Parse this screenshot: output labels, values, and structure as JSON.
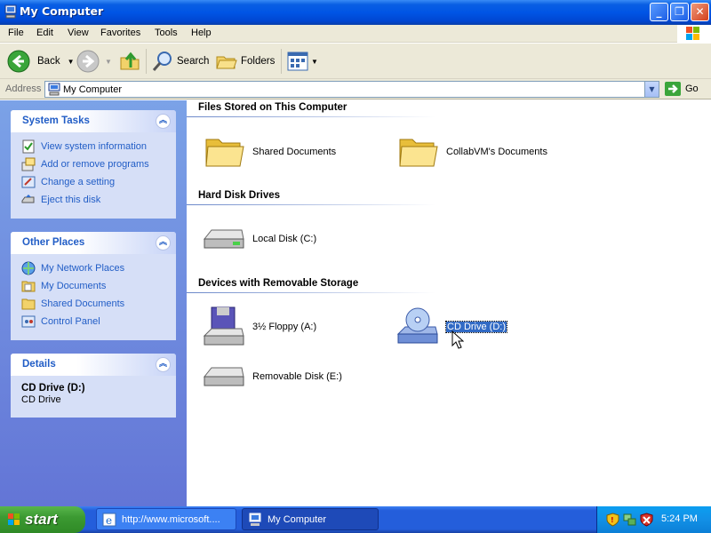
{
  "window": {
    "title": "My Computer"
  },
  "menu": [
    "File",
    "Edit",
    "View",
    "Favorites",
    "Tools",
    "Help"
  ],
  "toolbar": {
    "back": "Back",
    "search": "Search",
    "folders": "Folders"
  },
  "address": {
    "label": "Address",
    "value": "My Computer",
    "go": "Go"
  },
  "left": {
    "system_tasks": {
      "title": "System Tasks",
      "items": [
        "View system information",
        "Add or remove programs",
        "Change a setting",
        "Eject this disk"
      ]
    },
    "other_places": {
      "title": "Other Places",
      "items": [
        "My Network Places",
        "My Documents",
        "Shared Documents",
        "Control Panel"
      ]
    },
    "details": {
      "title": "Details",
      "name": "CD Drive (D:)",
      "type": "CD Drive"
    }
  },
  "groups": {
    "files": {
      "title": "Files Stored on This Computer",
      "items": [
        "Shared Documents",
        "CollabVM's Documents"
      ]
    },
    "hdd": {
      "title": "Hard Disk Drives",
      "items": [
        "Local Disk (C:)"
      ]
    },
    "removable": {
      "title": "Devices with Removable Storage",
      "items": [
        "3½ Floppy (A:)",
        "CD Drive (D:)",
        "Removable Disk (E:)"
      ]
    }
  },
  "taskbar": {
    "start": "start",
    "tasks": [
      "http://www.microsoft....",
      "My Computer"
    ],
    "clock": "5:24 PM"
  },
  "colors": {
    "titlebar": "#0055e5",
    "link": "#215dc6",
    "selection": "#316ac5",
    "taskbar": "#245edb"
  }
}
